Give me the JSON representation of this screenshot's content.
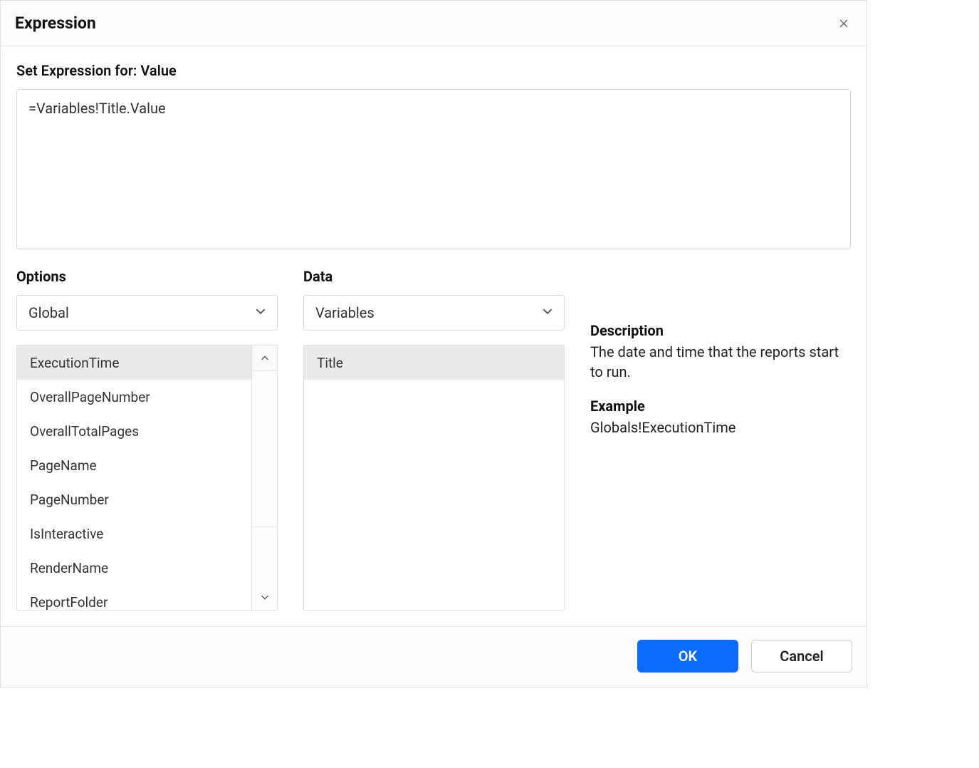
{
  "dialog": {
    "title": "Expression",
    "set_expression_label": "Set Expression for: Value",
    "expression_value": "=Variables!Title.Value"
  },
  "options": {
    "heading": "Options",
    "selected": "Global",
    "items": [
      "ExecutionTime",
      "OverallPageNumber",
      "OverallTotalPages",
      "PageName",
      "PageNumber",
      "IsInteractive",
      "RenderName",
      "ReportFolder"
    ],
    "selected_index": 0
  },
  "data": {
    "heading": "Data",
    "selected": "Variables",
    "items": [
      "Title"
    ],
    "selected_index": 0
  },
  "info": {
    "description_heading": "Description",
    "description_text": "The date and time that the reports start to run.",
    "example_heading": "Example",
    "example_text": "Globals!ExecutionTime"
  },
  "footer": {
    "ok_label": "OK",
    "cancel_label": "Cancel"
  }
}
